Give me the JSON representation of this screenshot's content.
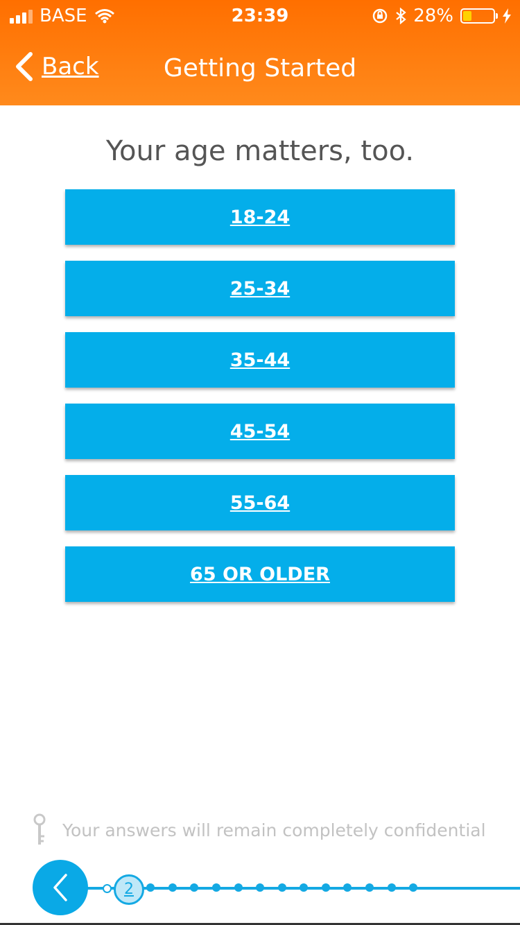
{
  "status_bar": {
    "carrier": "BASE",
    "time": "23:39",
    "battery_percent": "28%",
    "battery_level": 0.28,
    "battery_color": "#ffd200"
  },
  "nav": {
    "back_label": "Back",
    "title": "Getting Started"
  },
  "heading": "Your age matters, too.",
  "options": [
    "18-24",
    "25-34",
    "35-44",
    "45-54",
    "55-64",
    "65 OR OLDER"
  ],
  "footer": {
    "confidential_text": "Your answers will remain completely confidential",
    "icon": "key-icon"
  },
  "progress": {
    "current_step": "2"
  },
  "colors": {
    "header": "#ff7a0a",
    "button": "#04aeea",
    "progress": "#14a9e3"
  }
}
